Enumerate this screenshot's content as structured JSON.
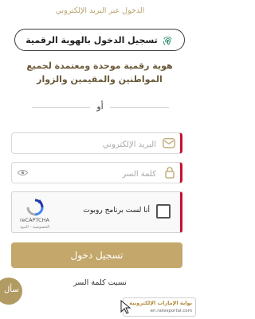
{
  "top_label": "الدخول عبر البريد الإلكتروني",
  "uaepass_button": {
    "label": "تسجيل الدخول بالهوية الرقمية",
    "icon": "fingerprint-icon"
  },
  "description": "هوية رقمية موحدة ومعتمدة لجميع المواطنين والمقيمين والزوار",
  "divider_text": "أو",
  "email_field": {
    "value": "",
    "placeholder": "البريد الإلكتروني",
    "icon": "mail-icon"
  },
  "password_field": {
    "value": "",
    "placeholder": "كلمة السر",
    "icons": [
      "lock-icon",
      "eye-icon"
    ]
  },
  "captcha": {
    "label": "أنا لست برنامج روبوت",
    "brand": "reCAPTCHA",
    "links": "الخصوصية - البنود",
    "checked": false
  },
  "login_button": {
    "label": "تسجيل دخول"
  },
  "forgot_password": "نسيت كلمة السر",
  "chat_button": {
    "label": "سأل"
  },
  "portal_badge": {
    "title": "بوابة الإمارات الإلكترونية",
    "url": "en.ratesportal.com"
  },
  "colors": {
    "gold": "#c4a76a",
    "accent_red": "#c8102e",
    "text_gold": "#6a5a3a"
  }
}
